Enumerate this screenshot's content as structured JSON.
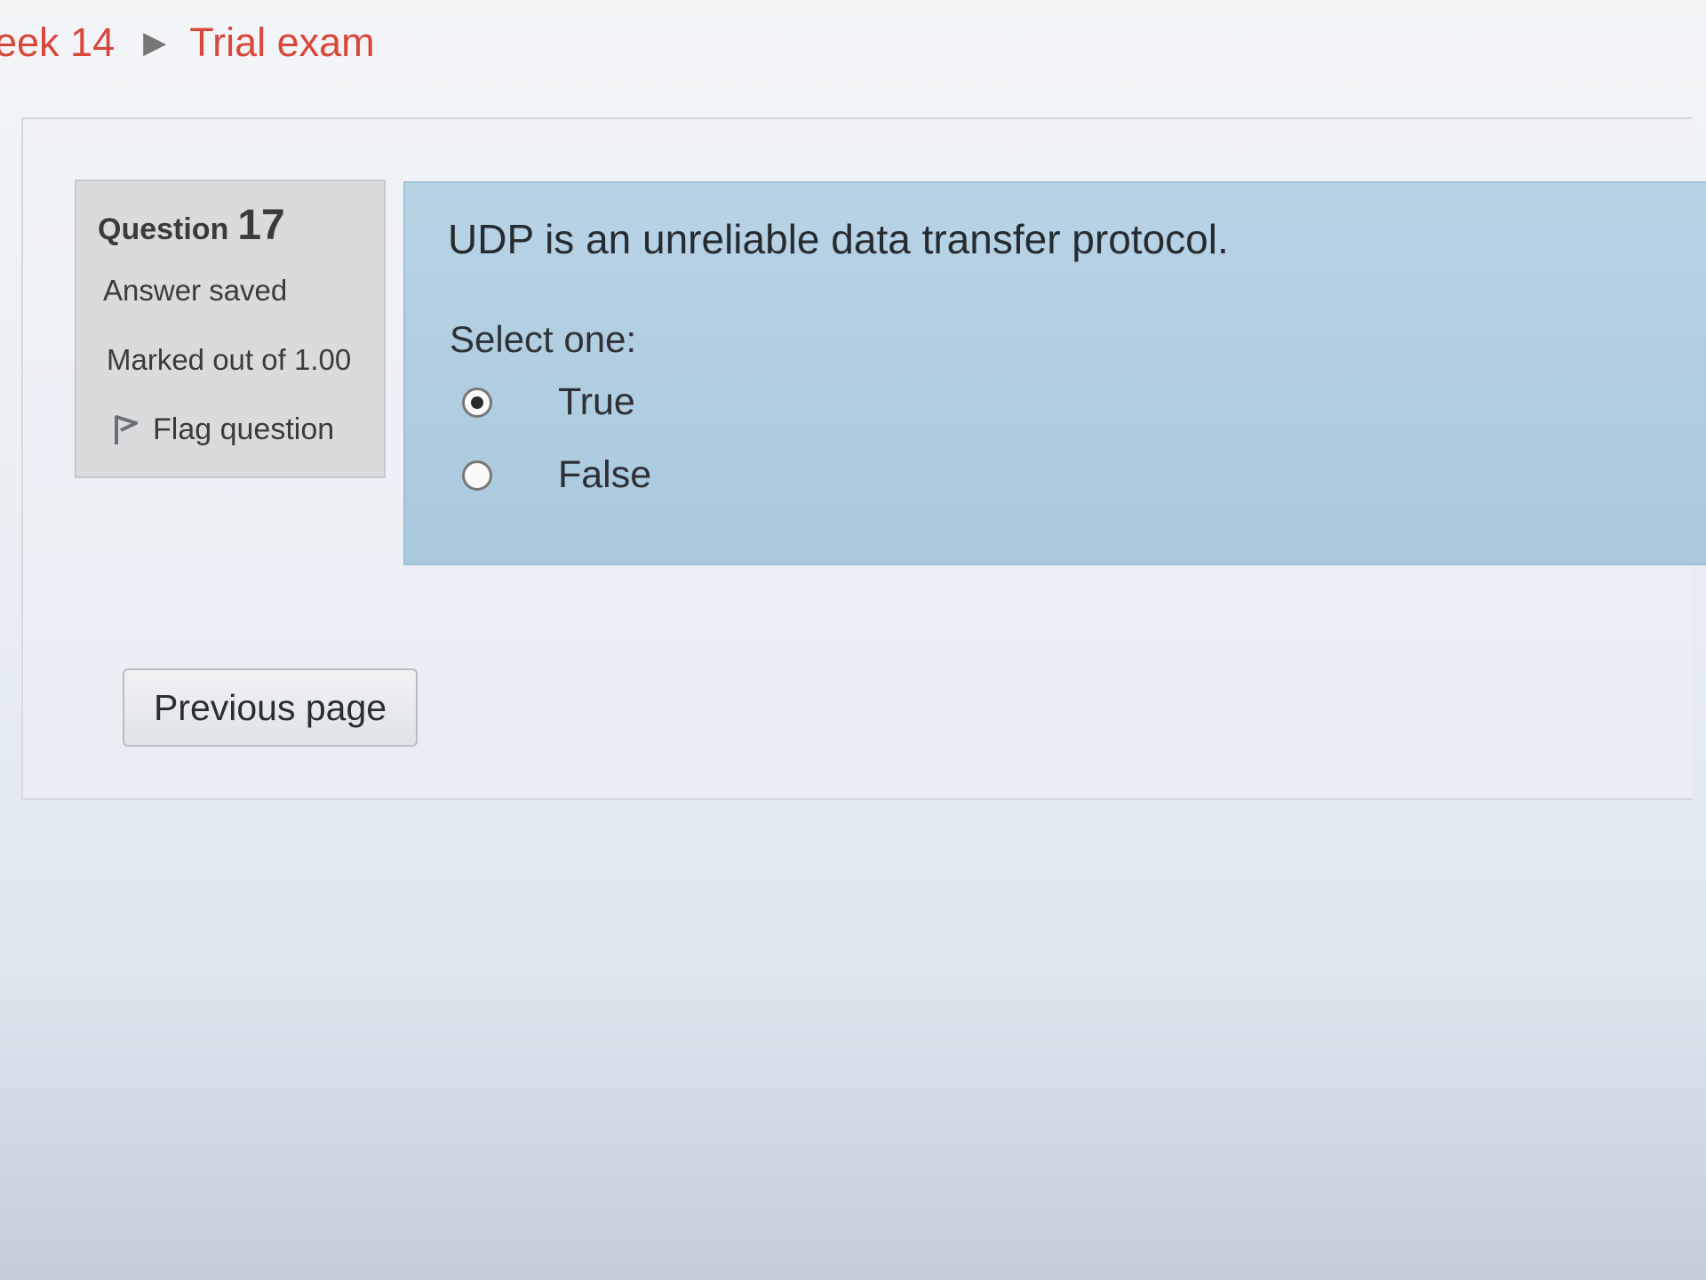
{
  "breadcrumb": {
    "week": "eek 14",
    "separator": "▶",
    "current": "Trial exam"
  },
  "question_info": {
    "label": "Question",
    "number": "17",
    "state": "Answer saved",
    "grade": "Marked out of 1.00",
    "flag_label": "Flag question",
    "flag_icon": "flag-icon"
  },
  "formulation": {
    "question_text": "UDP is an unreliable data transfer protocol.",
    "prompt": "Select one:",
    "options": [
      {
        "label": "True",
        "selected": true
      },
      {
        "label": "False",
        "selected": false
      }
    ]
  },
  "navigation": {
    "previous_label": "Previous page"
  },
  "colors": {
    "breadcrumb_link": "#d9473b",
    "question_panel": "#b9d3e5",
    "info_panel": "#d9dbdd"
  }
}
